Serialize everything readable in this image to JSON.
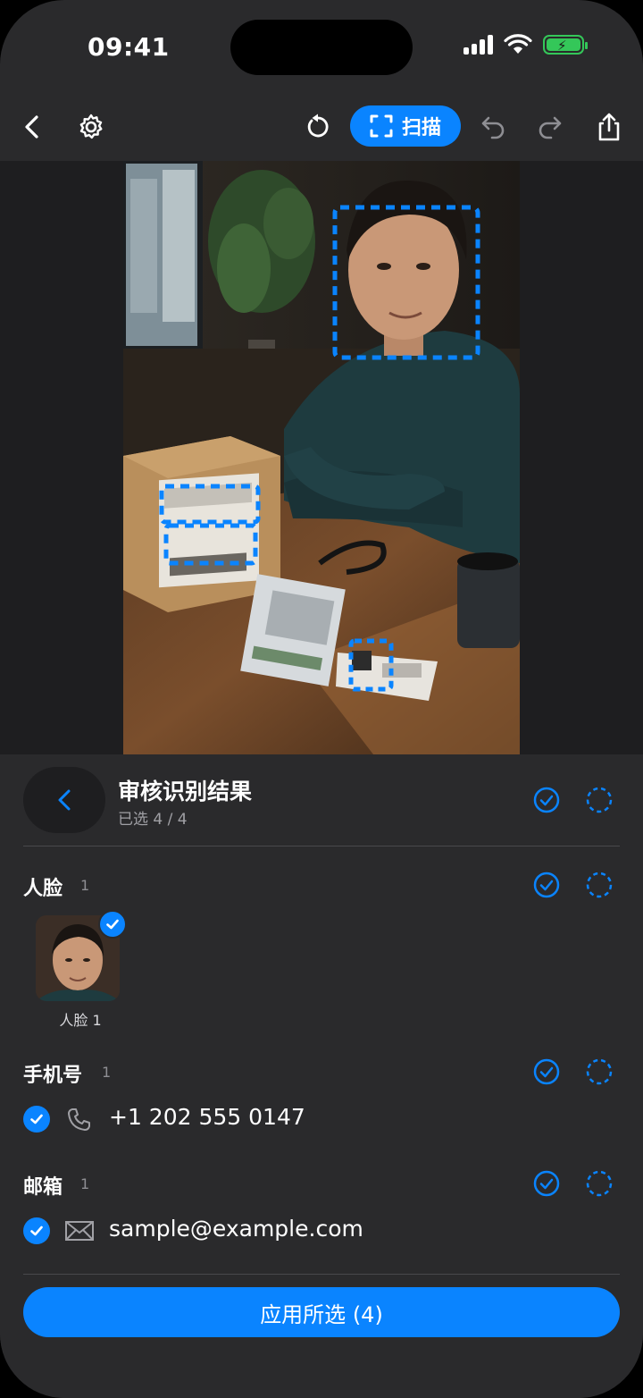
{
  "status_bar": {
    "time": "09:41"
  },
  "toolbar": {
    "scan_label": "扫描",
    "icons": [
      "back-icon",
      "gear-icon",
      "rotate-icon",
      "scan-frame-icon",
      "undo-icon",
      "redo-icon",
      "share-icon"
    ]
  },
  "review": {
    "title": "审核识别结果",
    "subtitle": "已选 4 / 4"
  },
  "sections": {
    "faces": {
      "title": "人脸",
      "count": "1",
      "items": [
        {
          "label": "人脸 1"
        }
      ]
    },
    "phones": {
      "title": "手机号",
      "count": "1",
      "items": [
        {
          "value": "+1 202 555 0147"
        }
      ]
    },
    "emails": {
      "title": "邮箱",
      "count": "1",
      "items": [
        {
          "value": "sample@example.com"
        }
      ]
    }
  },
  "apply_button": {
    "label": "应用所选 (4)"
  },
  "colors": {
    "accent": "#0a84ff",
    "panel": "#2a2a2c",
    "battery": "#34c759"
  }
}
